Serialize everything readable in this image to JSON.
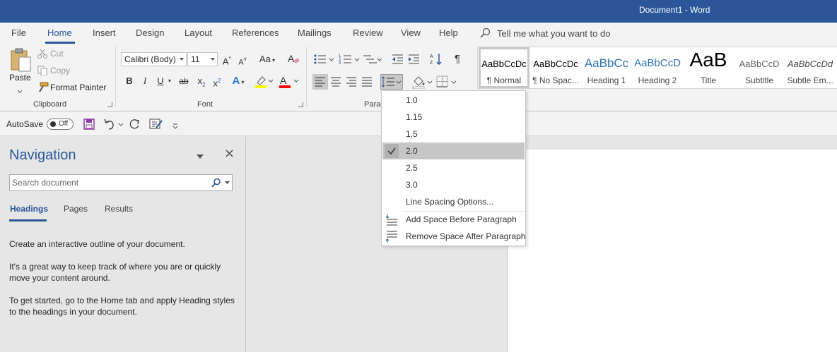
{
  "window": {
    "title": "Document1  -  Word"
  },
  "tabs": [
    "File",
    "Home",
    "Insert",
    "Design",
    "Layout",
    "References",
    "Mailings",
    "Review",
    "View",
    "Help"
  ],
  "tell_me": "Tell me what you want to do",
  "clipboard": {
    "paste": "Paste",
    "cut": "Cut",
    "copy": "Copy",
    "format_painter": "Format Painter",
    "group_label": "Clipboard"
  },
  "font": {
    "name": "Calibri (Body)",
    "size": "11",
    "change_case": "Aa",
    "group_label": "Font",
    "bold": "B",
    "italic": "I",
    "underline": "U",
    "strike": "ab",
    "subscript": "x",
    "sub_mark": "2",
    "superscript": "x",
    "sup_mark": "2",
    "text_effects": "A",
    "font_color": "A",
    "grow": "A",
    "shrink": "A",
    "highlight_color": "#ffff00",
    "font_color_bar": "#ff0000"
  },
  "paragraph": {
    "group_label": "Paragraph",
    "group_label_visible": "Parag"
  },
  "styles": [
    {
      "preview": "AaBbCcDc",
      "name": "¶ Normal"
    },
    {
      "preview": "AaBbCcDc",
      "name": "¶ No Spac..."
    },
    {
      "preview": "AaBbCc",
      "name": "Heading 1"
    },
    {
      "preview": "AaBbCcD",
      "name": "Heading 2"
    },
    {
      "preview": "AaB",
      "name": "Title"
    },
    {
      "preview": "AaBbCcD",
      "name": "Subtitle"
    },
    {
      "preview": "AaBbCcDd",
      "name": "Subtle Em..."
    }
  ],
  "qat": {
    "autosave_label": "AutoSave",
    "autosave_state": "Off"
  },
  "navigation": {
    "title": "Navigation",
    "search_placeholder": "Search document",
    "tabs": [
      "Headings",
      "Pages",
      "Results"
    ],
    "para1": "Create an interactive outline of your document.",
    "para2": "It's a great way to keep track of where you are or quickly move your content around.",
    "para3": "To get started, go to the Home tab and apply Heading styles to the headings in your document."
  },
  "line_spacing_menu": {
    "options": [
      "1.0",
      "1.15",
      "1.5",
      "2.0",
      "2.5",
      "3.0"
    ],
    "selected": "2.0",
    "line_spacing_options": "Line Spacing Options...",
    "add_space_before": "Add Space Before Paragraph",
    "remove_space_after": "Remove Space After Paragraph"
  },
  "colors": {
    "brand": "#2b579a",
    "ribbon_bg": "#f3f3f3",
    "pane_bg": "#e6e6e6",
    "menu_selected_bg": "#c6c6c6"
  }
}
